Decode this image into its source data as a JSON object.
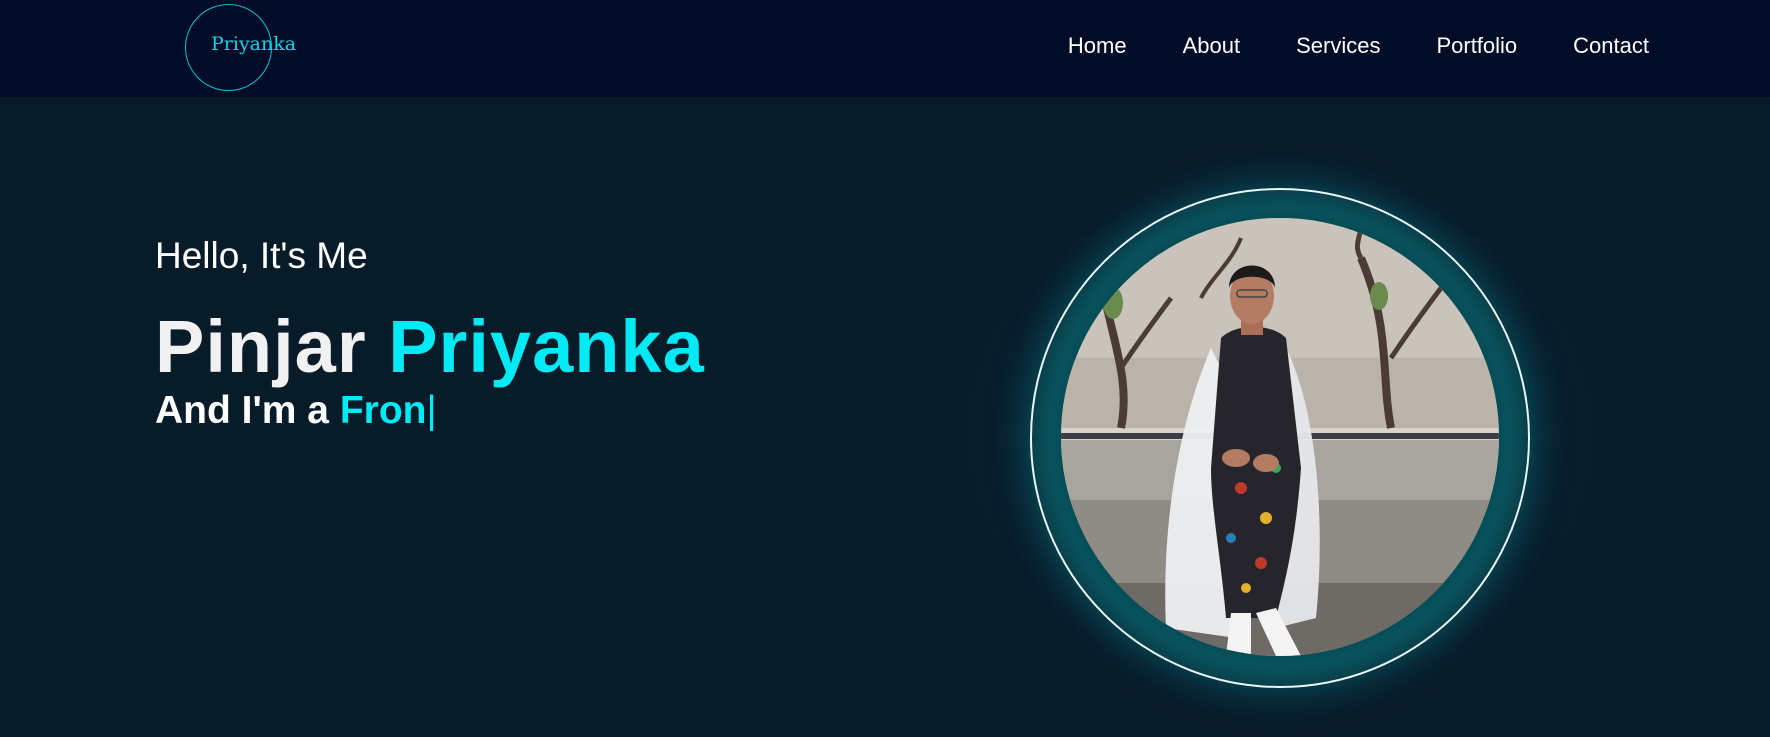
{
  "header": {
    "logo_text": "Priyanka",
    "nav": [
      {
        "label": "Home"
      },
      {
        "label": "About"
      },
      {
        "label": "Services"
      },
      {
        "label": "Portfolio"
      },
      {
        "label": "Contact"
      }
    ]
  },
  "hero": {
    "greeting": "Hello, It's Me",
    "first_name": "Pinjar",
    "last_name": "Priyanka",
    "role_prefix": "And I'm a",
    "role_typed": "Fron",
    "cursor": "|"
  },
  "colors": {
    "accent": "#00eaf5",
    "nav_bg": "#020c27",
    "page_bg": "#081b29"
  }
}
